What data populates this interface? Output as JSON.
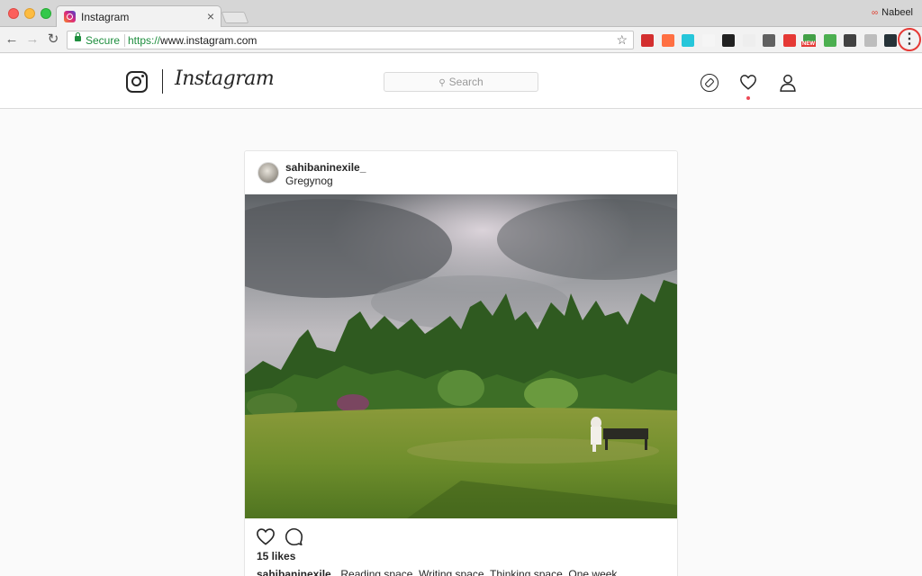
{
  "browser": {
    "tab": {
      "title": "Instagram",
      "close": "×"
    },
    "profile_name": "Nabeel",
    "address": {
      "secure_label": "Secure",
      "scheme": "https://",
      "host": "www.instagram.com"
    },
    "extensions": [
      {
        "name": "lastpass-extension",
        "color": "#d32f2f"
      },
      {
        "name": "toggl-extension",
        "color": "#ff7043"
      },
      {
        "name": "grammar-extension",
        "color": "#26c6da"
      },
      {
        "name": "blank-extension",
        "color": "#f5f5f5"
      },
      {
        "name": "dark-extension",
        "color": "#212121"
      },
      {
        "name": "download-extension",
        "color": "#eeeeee"
      },
      {
        "name": "mixmax-extension",
        "color": "#616161"
      },
      {
        "name": "adblock-extension",
        "color": "#e53935"
      },
      {
        "name": "new-badge-extension",
        "color": "#43a047"
      },
      {
        "name": "wave-extension",
        "color": "#4caf50"
      },
      {
        "name": "film-extension",
        "color": "#424242"
      },
      {
        "name": "cloud-extension",
        "color": "#bdbdbd"
      },
      {
        "name": "buffer-extension",
        "color": "#263238"
      }
    ],
    "new_badge": "NEW"
  },
  "instagram": {
    "wordmark": "Instagram",
    "search_placeholder": "Search"
  },
  "post": {
    "username": "sahibaninexile_",
    "location": "Gregynog",
    "likes": "15 likes",
    "caption_user": "sahibaninexile_",
    "caption_text": "Reading space. Writing space. Thinking space. One week"
  }
}
